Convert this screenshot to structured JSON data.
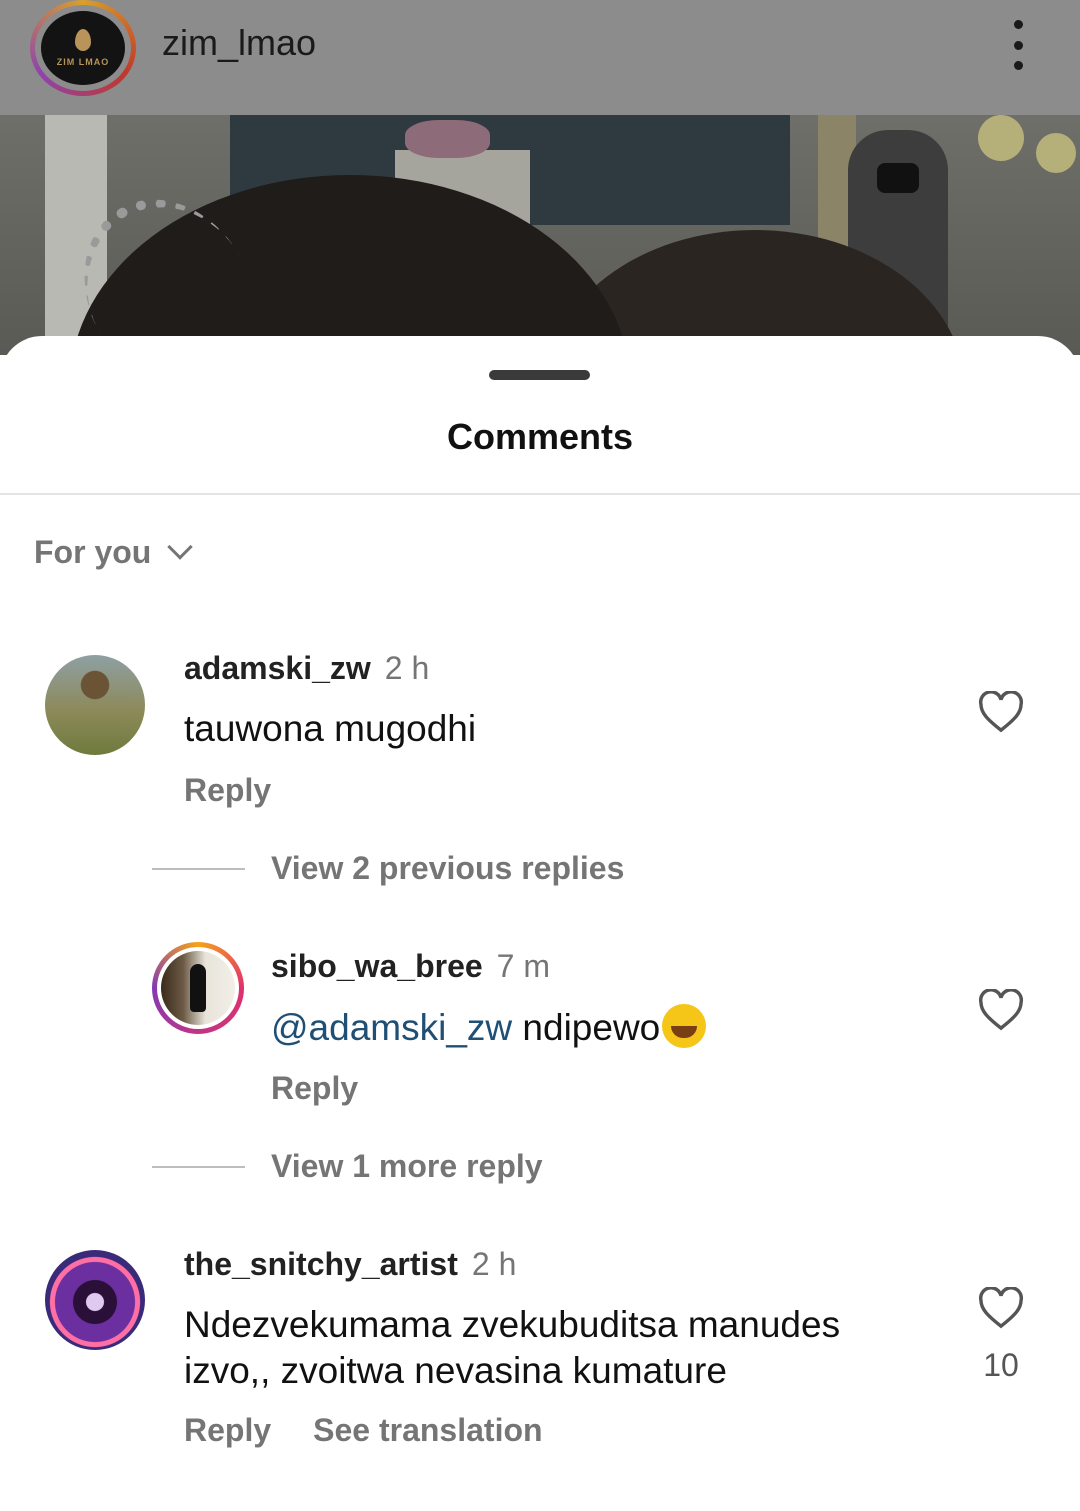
{
  "header": {
    "username": "zim_lmao",
    "logo_text": "ZIM LMAO"
  },
  "sheet": {
    "title": "Comments",
    "filter_label": "For you"
  },
  "comments": [
    {
      "username": "adamski_zw",
      "time": "2 h",
      "text": "tauwona mugodhi",
      "reply_label": "Reply",
      "replies_toggle": "View 2 previous replies"
    },
    {
      "username": "sibo_wa_bree",
      "time": "7 m",
      "mention": "@adamski_zw",
      "text": "ndipewo",
      "reply_label": "Reply",
      "replies_toggle": "View 1 more reply"
    },
    {
      "username": "the_snitchy_artist",
      "time": "2 h",
      "text_line1": "Ndezvekumama zvekubuditsa manudes",
      "text_line2": "izvo,, zvoitwa nevasina kumature",
      "reply_label": "Reply",
      "translate_label": "See translation",
      "like_count": "10"
    }
  ]
}
